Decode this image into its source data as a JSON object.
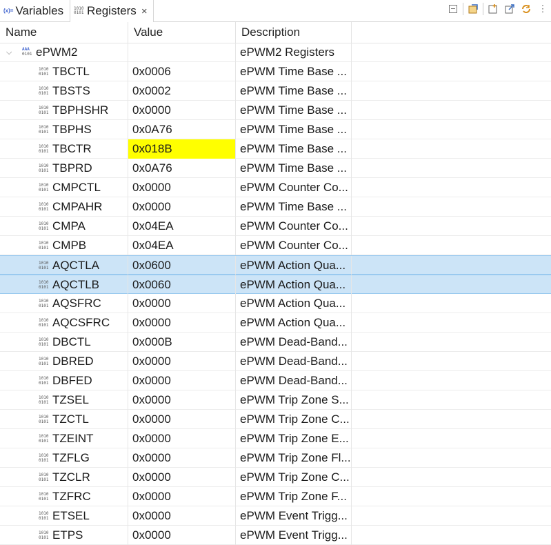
{
  "tabs": [
    {
      "label": "Variables",
      "icon": "(x)="
    },
    {
      "label": "Registers",
      "icon_top": "1010",
      "icon_bottom": "0101",
      "close": "×"
    }
  ],
  "toolbar": [
    {
      "name": "collapse-all-icon"
    },
    {
      "name": "show-all-icon"
    },
    {
      "name": "new-view-icon"
    },
    {
      "name": "export-icon"
    },
    {
      "name": "refresh-icon"
    },
    {
      "name": "view-menu-icon",
      "glyph": "⋮"
    }
  ],
  "columns": {
    "name": "Name",
    "value": "Value",
    "description": "Description"
  },
  "group": {
    "name": "ePWM2",
    "description": "ePWM2 Registers"
  },
  "rows": [
    {
      "name": "TBCTL",
      "value": "0x0006",
      "description": "ePWM Time Base ..."
    },
    {
      "name": "TBSTS",
      "value": "0x0002",
      "description": "ePWM Time Base ..."
    },
    {
      "name": "TBPHSHR",
      "value": "0x0000",
      "description": "ePWM Time Base ..."
    },
    {
      "name": "TBPHS",
      "value": "0x0A76",
      "description": "ePWM Time Base ..."
    },
    {
      "name": "TBCTR",
      "value": "0x018B",
      "description": "ePWM Time Base ...",
      "changed": true
    },
    {
      "name": "TBPRD",
      "value": "0x0A76",
      "description": "ePWM Time Base ..."
    },
    {
      "name": "CMPCTL",
      "value": "0x0000",
      "description": "ePWM Counter Co..."
    },
    {
      "name": "CMPAHR",
      "value": "0x0000",
      "description": "ePWM Time Base ..."
    },
    {
      "name": "CMPA",
      "value": "0x04EA",
      "description": "ePWM Counter Co..."
    },
    {
      "name": "CMPB",
      "value": "0x04EA",
      "description": "ePWM Counter Co..."
    },
    {
      "name": "AQCTLA",
      "value": "0x0600",
      "description": "ePWM Action Qua...",
      "selected": true
    },
    {
      "name": "AQCTLB",
      "value": "0x0060",
      "description": "ePWM Action Qua...",
      "selected": true
    },
    {
      "name": "AQSFRC",
      "value": "0x0000",
      "description": "ePWM Action Qua..."
    },
    {
      "name": "AQCSFRC",
      "value": "0x0000",
      "description": "ePWM Action Qua..."
    },
    {
      "name": "DBCTL",
      "value": "0x000B",
      "description": "ePWM Dead-Band..."
    },
    {
      "name": "DBRED",
      "value": "0x0000",
      "description": "ePWM Dead-Band..."
    },
    {
      "name": "DBFED",
      "value": "0x0000",
      "description": "ePWM Dead-Band..."
    },
    {
      "name": "TZSEL",
      "value": "0x0000",
      "description": "ePWM Trip Zone S..."
    },
    {
      "name": "TZCTL",
      "value": "0x0000",
      "description": "ePWM Trip Zone C..."
    },
    {
      "name": "TZEINT",
      "value": "0x0000",
      "description": "ePWM Trip Zone E..."
    },
    {
      "name": "TZFLG",
      "value": "0x0000",
      "description": "ePWM Trip Zone Fl..."
    },
    {
      "name": "TZCLR",
      "value": "0x0000",
      "description": "ePWM Trip Zone C..."
    },
    {
      "name": "TZFRC",
      "value": "0x0000",
      "description": "ePWM Trip Zone F..."
    },
    {
      "name": "ETSEL",
      "value": "0x0000",
      "description": "ePWM Event Trigg..."
    },
    {
      "name": "ETPS",
      "value": "0x0000",
      "description": "ePWM Event Trigg..."
    }
  ],
  "colors": {
    "changed_value": "#ffff00",
    "selection": "#cce4f7"
  }
}
